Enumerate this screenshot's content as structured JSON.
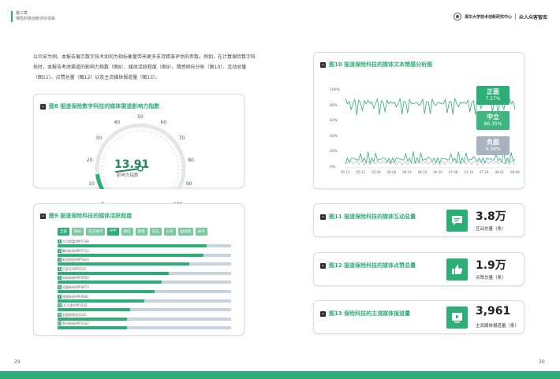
{
  "header": {
    "chapter": "第三章",
    "subtitle": "保险科技创新评价体系",
    "logo_org": "清华大学技术创新研究中心",
    "logo_brand": "众人众客智库"
  },
  "intro": "以众安为例，本报告展示数字技术如何为指标衡量带来更多支持精准评估的参数。例如，在计算保险数字科技时，本报告考虑渠道的影响力指数（图8）、媒体活跃程度（图9）、情感倾向分析（图10）、互动总量（图11）、点赞总量（图12）以及主流媒体报道量（图13）。",
  "fig8": {
    "title": "图8 报道保险数字科技的媒体渠道影响力指数",
    "value": "13.91",
    "unit": "影响力指数",
    "ticks": [
      "0",
      "10",
      "20",
      "30",
      "40",
      "50",
      "60",
      "70",
      "80",
      "90",
      "100"
    ],
    "gauge_value": 13.91
  },
  "fig9": {
    "title": "图9 报道保险科技的媒体活跃程度",
    "tags": [
      "全部",
      "网站",
      "电子报刊",
      "APP",
      "微信",
      "微博",
      "论坛",
      "头条",
      "短视频",
      "知乎"
    ],
    "rows": [
      {
        "rank": "1",
        "name": "东方财富APP5708",
        "value": 0.86
      },
      {
        "rank": "2",
        "name": "腾讯新闻APP5712",
        "value": 0.84
      },
      {
        "rank": "3",
        "name": "新浪财经APP5623",
        "value": 0.76
      },
      {
        "rank": "4",
        "name": "百家号APP5525",
        "value": 0.64
      },
      {
        "rank": "5",
        "name": "网易新闻APP4950",
        "value": 0.6
      },
      {
        "rank": "6",
        "name": "凤凰新闻APP4873",
        "value": 0.56
      },
      {
        "rank": "7",
        "name": "搜狐新闻APP4681",
        "value": 0.5
      },
      {
        "rank": "8",
        "name": "UC头条APP3583",
        "value": 0.42
      },
      {
        "rank": "9",
        "name": "金融界网站3243",
        "value": 0.4
      },
      {
        "rank": "10",
        "name": "和讯新闻APP3162",
        "value": 0.4
      }
    ]
  },
  "fig10": {
    "title": "图10 报道保险科技的媒体文本情感分析图",
    "y_ticks": [
      "100%",
      "80%",
      "60%",
      "40%",
      "20%",
      "0%"
    ],
    "x_ticks": [
      "05-13",
      "05-21",
      "05-29",
      "06-06",
      "06-14",
      "06-22",
      "06-30",
      "07-08",
      "07-16",
      "07-24",
      "08-01",
      "08-09"
    ],
    "sentiments": [
      {
        "name": "正面",
        "value": "7.27%",
        "color": "#2eae77"
      },
      {
        "name": "中立",
        "value": "86.35%",
        "color": "#3fb57f"
      },
      {
        "name": "负面",
        "value": "6.38%",
        "color": "#a9b3bd"
      }
    ],
    "colors": {
      "line": "#2eae77"
    }
  },
  "fig11": {
    "title": "图11 报道保险科技的媒体互动总量",
    "value": "3.8万",
    "unit": "互动总量（条）",
    "icon": "chat-icon"
  },
  "fig12": {
    "title": "图12 报道保险科技的媒体点赞总量",
    "value": "1.9万",
    "unit": "点赞总量（条）",
    "icon": "thumbs-up-icon"
  },
  "fig13": {
    "title": "图13 保险科技的主流媒体报道量",
    "value": "3,961",
    "unit": "主流媒体报道量（条）",
    "icon": "video-icon"
  },
  "page": {
    "left": "29",
    "right": "30"
  },
  "colors": {
    "accent": "#2eae77",
    "bar_track": "#c8d3e0"
  }
}
